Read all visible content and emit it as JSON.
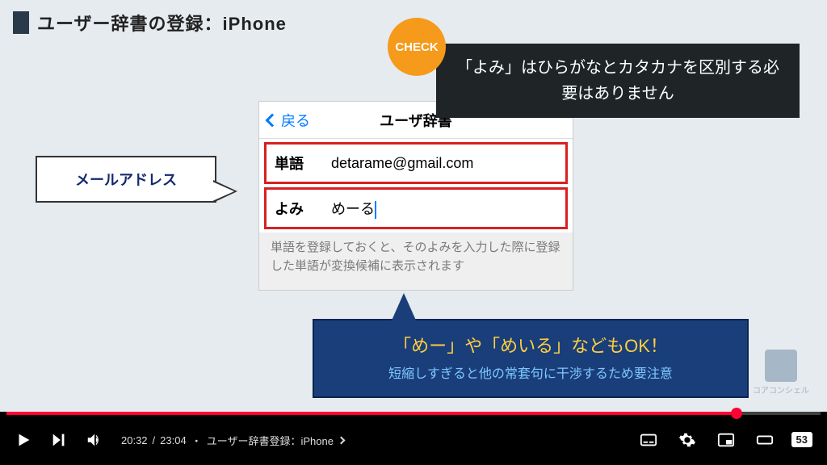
{
  "slide": {
    "title": "ユーザー辞書の登録：iPhone",
    "check_badge": "CHECK",
    "callout_left": "メールアドレス",
    "callout_dark": "「よみ」はひらがなとカタカナを区別する必要はありません",
    "callout_blue_line1": "「めー」や「めいる」などもOK！",
    "callout_blue_line2": "短縮しすぎると他の常套句に干渉するため要注意",
    "watermark": "コアコンシェル"
  },
  "phone": {
    "back": "戻る",
    "title": "ユーザ辞書",
    "word_label": "単語",
    "word_value": "detarame@gmail.com",
    "yomi_label": "よみ",
    "yomi_value": "めーる",
    "hint": "単語を登録しておくと、そのよみを入力した際に登録した単語が変換候補に表示されます"
  },
  "player": {
    "current_time": "20:32",
    "duration": "23:04",
    "chapter": "ユーザー辞書登録：iPhone",
    "progress_percent": 89,
    "skip": "53"
  },
  "colors": {
    "accent_red": "#d82020",
    "blue": "#1a3e7a",
    "orange": "#f59a1a"
  }
}
